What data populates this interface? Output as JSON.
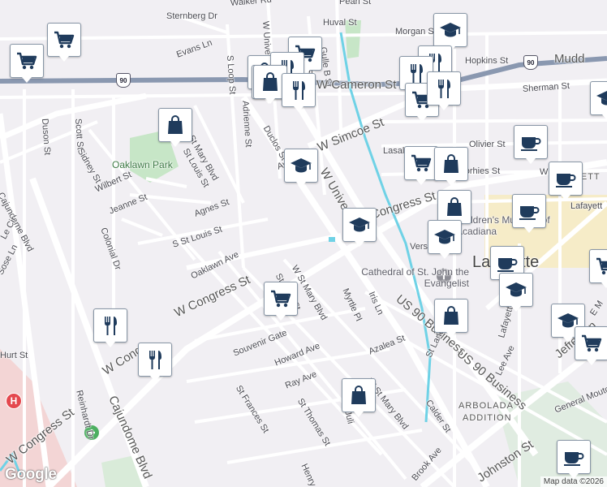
{
  "map": {
    "streets": [
      "Walker Rd",
      "Sternberg Dr",
      "Pearl St",
      "Huval St",
      "Morgan St",
      "Hopkins St",
      "Mudd",
      "Evans Ln",
      "S Loop St",
      "Adrienne St",
      "W Universit",
      "Belle St",
      "Gulle B St",
      "W Cameron St",
      "Sherman St",
      "Duson St",
      "Scott St",
      "W St Mary Blvd",
      "Duclos St",
      "W Simcoe St",
      "Olivier St",
      "Lasalle",
      "Vorhies St",
      "W",
      "Sidney St",
      "St Louis St",
      "Wilbert St",
      "Jeanne St",
      "Agnes St",
      "S St Louis St",
      "W University",
      "W Congress St",
      "Colonial Dr",
      "Cajundome Blvd",
      "Ave",
      "Oaklawn Ave",
      "Versailles Bl",
      "W Congress St",
      "W St Mary Blvd",
      "St John St",
      "Myrtle Pl",
      "Iris Ln",
      "US 90 Business",
      "US 90 Business",
      "Lafayette St",
      "Jefferson",
      "Souvenir Gate",
      "Howard Ave",
      "St Frances St",
      "Ray Ave",
      "St Thomas St",
      "Azalea St",
      "St Landry St",
      "W St Mary Blvd",
      "Lee Ave",
      "General Mouton",
      "Calder St",
      "Reinhardt Dr",
      "Cajundome Blvd",
      "W Congress St",
      "W Cong",
      "Brook Ave",
      "Johnston St",
      "Henry St",
      "Juli",
      "E M",
      "Sose Ln",
      "Hurt St",
      "Le Cir",
      "Lafayett"
    ],
    "places": [
      "Oaklawn Park",
      "Children's Museum of Acadiana",
      "Cathedral of St. John the Evangelist",
      "Lafayette",
      "ARBOLADA",
      "ADDITION",
      "AYETT"
    ],
    "highway_shields": [
      "90",
      "90"
    ],
    "attribution": "Map data ©2026",
    "logo": "Google"
  },
  "markers": [
    {
      "icon": "shopping-cart-icon"
    },
    {
      "icon": "shopping-cart-icon"
    },
    {
      "icon": "shopping-bag-icon"
    },
    {
      "icon": "graduation-cap-icon"
    },
    {
      "icon": "restaurant-icon"
    },
    {
      "icon": "shopping-cart-icon"
    },
    {
      "icon": "shopping-bag-icon"
    },
    {
      "icon": "restaurant-icon"
    },
    {
      "icon": "shopping-cart-icon"
    },
    {
      "icon": "shopping-bag-icon"
    },
    {
      "icon": "graduation-cap-icon"
    },
    {
      "icon": "graduation-cap-icon"
    },
    {
      "icon": "restaurant-icon"
    },
    {
      "icon": "restaurant-icon"
    },
    {
      "icon": "shopping-cart-icon"
    },
    {
      "icon": "restaurant-icon"
    },
    {
      "icon": "shopping-cart-icon"
    },
    {
      "icon": "shopping-bag-icon"
    },
    {
      "icon": "shopping-bag-icon"
    },
    {
      "icon": "graduation-cap-icon"
    },
    {
      "icon": "coffee-cup-icon"
    },
    {
      "icon": "coffee-cup-icon"
    },
    {
      "icon": "coffee-cup-icon"
    },
    {
      "icon": "coffee-cup-icon"
    },
    {
      "icon": "graduation-cap-icon"
    },
    {
      "icon": "shopping-cart-icon"
    },
    {
      "icon": "shopping-bag-icon"
    },
    {
      "icon": "graduation-cap-icon"
    },
    {
      "icon": "shopping-cart-icon"
    },
    {
      "icon": "restaurant-icon"
    },
    {
      "icon": "restaurant-icon"
    },
    {
      "icon": "shopping-cart-icon"
    },
    {
      "icon": "shopping-bag-icon"
    },
    {
      "icon": "coffee-cup-icon"
    },
    {
      "icon": "graduation-cap-icon"
    }
  ],
  "colors": {
    "land": "#f1eff3",
    "road": "#ffffff",
    "road_edge": "#d6d3dc",
    "highway": "#8a98b0",
    "park": "#c7e6c7",
    "water": "#6fd2e6",
    "downtown": "#f6ecc8",
    "hospital_area": "#f3d5d5",
    "marker_fill": "#1f3b5c"
  }
}
